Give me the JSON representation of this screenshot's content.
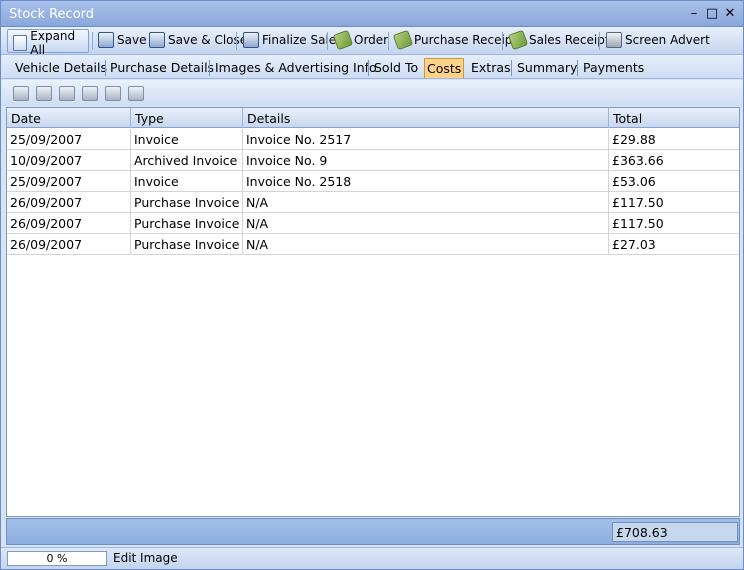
{
  "window": {
    "title": "Stock Record"
  },
  "toolbar": {
    "expand_all": "Expand All",
    "save": "Save",
    "save_close": "Save & Close",
    "finalize_sale": "Finalize Sale",
    "order": "Order",
    "purchase_receipt": "Purchase Receipt",
    "sales_receipt": "Sales Receipt",
    "screen_advert": "Screen Advert"
  },
  "tabs": [
    {
      "label": "Vehicle Details"
    },
    {
      "label": "Purchase Details"
    },
    {
      "label": "Images & Advertising Info"
    },
    {
      "label": "Sold To"
    },
    {
      "label": "Costs"
    },
    {
      "label": "Extras"
    },
    {
      "label": "Summary"
    },
    {
      "label": "Payments"
    }
  ],
  "active_tab": "Costs",
  "table": {
    "columns": [
      "Date",
      "Type",
      "Details",
      "Total"
    ],
    "rows": [
      {
        "date": "25/09/2007",
        "type": "Invoice",
        "details": "Invoice No. 2517",
        "total": "£29.88"
      },
      {
        "date": "10/09/2007",
        "type": "Archived Invoice",
        "details": "Invoice No. 9",
        "total": "£363.66"
      },
      {
        "date": "25/09/2007",
        "type": "Invoice",
        "details": "Invoice No. 2518",
        "total": "£53.06"
      },
      {
        "date": "26/09/2007",
        "type": "Purchase Invoice",
        "details": "N/A",
        "total": "£117.50"
      },
      {
        "date": "26/09/2007",
        "type": "Purchase Invoice",
        "details": "N/A",
        "total": "£117.50"
      },
      {
        "date": "26/09/2007",
        "type": "Purchase Invoice",
        "details": "N/A",
        "total": "£27.03"
      }
    ],
    "grand_total": "£708.63"
  },
  "status": {
    "progress": "0 %",
    "text": "Edit Image"
  }
}
